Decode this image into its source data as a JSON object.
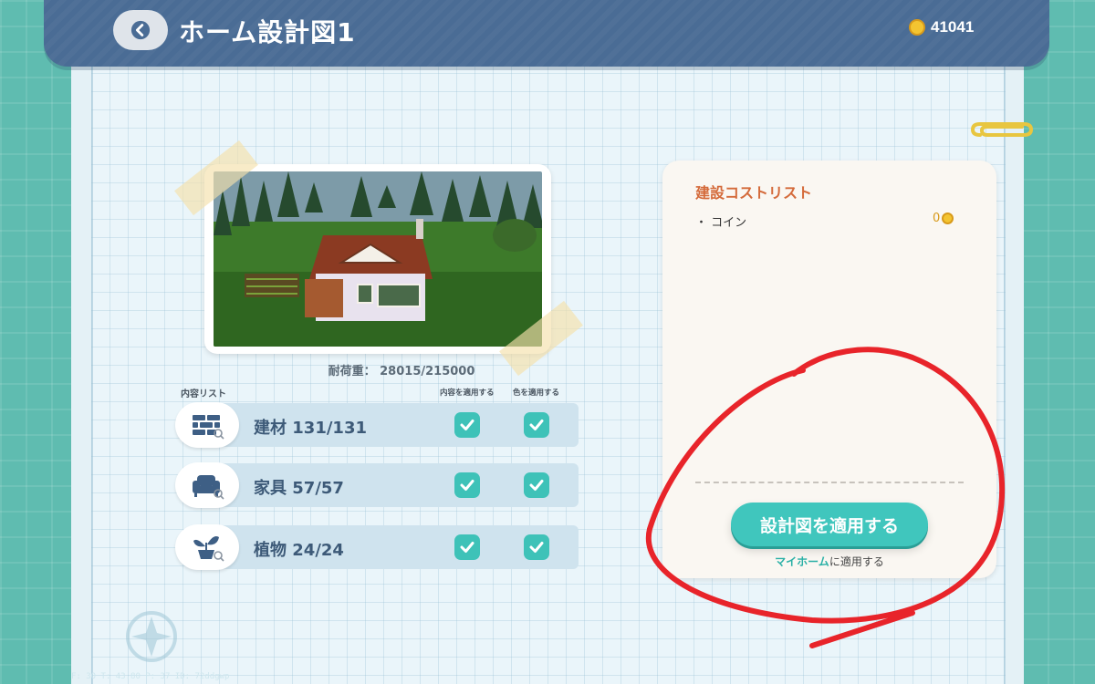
{
  "header": {
    "title": "ホーム設計図1",
    "coins": "41041",
    "back_icon": "chevron-left-icon"
  },
  "preview": {
    "load_label": "耐荷重： 28015/215000"
  },
  "content_list": {
    "label": "内容リスト",
    "col_apply_contents": "内容を適用する",
    "col_apply_color": "色を適用する",
    "rows": [
      {
        "icon": "bricks-icon",
        "label": "建材 131/131",
        "apply_contents": true,
        "apply_color": true
      },
      {
        "icon": "sofa-icon",
        "label": "家具 57/57",
        "apply_contents": true,
        "apply_color": true
      },
      {
        "icon": "plant-icon",
        "label": "植物 24/24",
        "apply_contents": true,
        "apply_color": true
      }
    ]
  },
  "cost_panel": {
    "title": "建設コストリスト",
    "items": [
      {
        "name": "・ コイン",
        "value": "0"
      }
    ],
    "apply_button": "設計図を適用する",
    "apply_note_highlight": "マイホーム",
    "apply_note_rest": "に適用する"
  },
  "debug": "F: 30   T: 43.80   P: 37   ID: 72ddgwp",
  "colors": {
    "header_bg": "#4a6c95",
    "accent": "#40c6bd",
    "annotation": "#e8242a"
  }
}
